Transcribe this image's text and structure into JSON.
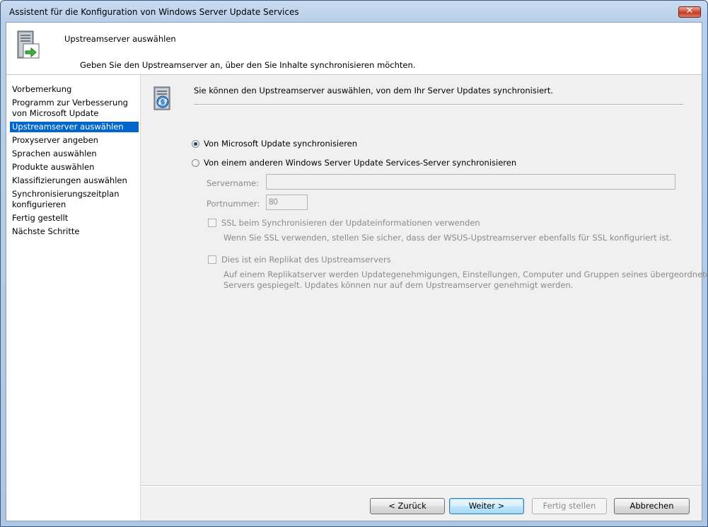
{
  "window": {
    "title": "Assistent für die Konfiguration von Windows Server Update Services",
    "close_symbol": "✕"
  },
  "header": {
    "title": "Upstreamserver auswählen",
    "subtitle": "Geben Sie den Upstreamserver an, über den Sie Inhalte synchronisieren möchten.",
    "icon": "server-icon"
  },
  "nav": {
    "items": [
      {
        "label": "Vorbemerkung"
      },
      {
        "label": "Programm zur Verbesserung von Microsoft Update"
      },
      {
        "label": "Upstreamserver auswählen",
        "active": true
      },
      {
        "label": "Proxyserver angeben"
      },
      {
        "label": "Sprachen auswählen"
      },
      {
        "label": "Produkte auswählen"
      },
      {
        "label": "Klassifizierungen auswählen"
      },
      {
        "label": "Synchronisierungszeitplan konfigurieren"
      },
      {
        "label": "Fertig gestellt"
      },
      {
        "label": "Nächste Schritte"
      }
    ]
  },
  "main": {
    "icon": "sync-server-icon",
    "intro": "Sie können den Upstreamserver auswählen, von dem Ihr Server Updates synchronisiert.",
    "options": {
      "microsoft": {
        "label": "Von Microsoft Update synchronisieren",
        "selected": true
      },
      "other": {
        "label": "Von einem anderen Windows Server Update Services-Server synchronisieren",
        "selected": false
      }
    },
    "servername": {
      "label": "Servername:",
      "value": ""
    },
    "port": {
      "label": "Portnummer:",
      "value": "80"
    },
    "ssl": {
      "label": "SSL beim Synchronisieren der Updateinformationen verwenden",
      "checked": false,
      "description": "Wenn Sie SSL verwenden, stellen Sie sicher, dass der WSUS-Upstreamserver ebenfalls für SSL konfiguriert ist."
    },
    "replica": {
      "label": "Dies ist ein Replikat des Upstreamservers",
      "checked": false,
      "description_line1": "Auf einem Replikatserver werden Updategenehmigungen, Einstellungen, Computer und Gruppen seines übergeordneten",
      "description_line2": "Servers gespiegelt. Updates können nur auf dem Upstreamserver genehmigt werden."
    }
  },
  "buttons": {
    "back": "< Zurück",
    "next": "Weiter >",
    "finish": "Fertig stellen",
    "cancel": "Abbrechen"
  }
}
